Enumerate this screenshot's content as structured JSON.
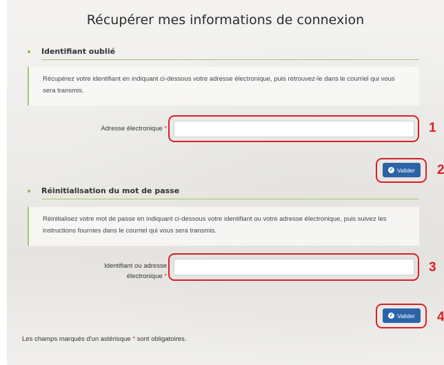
{
  "page": {
    "title": "Récupérer mes informations de connexion"
  },
  "forgot_id": {
    "heading": "Identifiant oublié",
    "description": "Récupérez votre identifiant en indiquant ci-dessous votre adresse électronique, puis retrouvez-le dans le courriel qui vous sera transmis.",
    "field_label": "Adresse électronique",
    "required_mark": "*",
    "field_value": "",
    "submit_label": "Valider"
  },
  "reset_password": {
    "heading": "Réinitialisation du mot de passe",
    "description": "Réinitialisez votre mot de passe en indiquant ci-dessous votre identifiant ou votre adresse électronique, puis suivez les instructions fournies dans le courriel qui vous sera transmis.",
    "field_label_line1": "Identifiant ou adresse",
    "field_label_line2": "électronique",
    "required_mark": "*",
    "field_value": "",
    "submit_label": "Valider"
  },
  "footer": {
    "note_before": "Les champs marqués d'un astérisque",
    "required_mark": "*",
    "note_after": "sont obligatoires."
  },
  "annotations": {
    "callout_1": "1",
    "callout_2": "2",
    "callout_3": "3",
    "callout_4": "4",
    "color": "#d81f26"
  },
  "colors": {
    "accent_green": "#8bbf3a",
    "button_blue": "#2c63a8",
    "required_red": "#e3262b"
  },
  "icons": {
    "submit_icon": "check-circle-icon",
    "section_bullet": "bullet-icon"
  }
}
